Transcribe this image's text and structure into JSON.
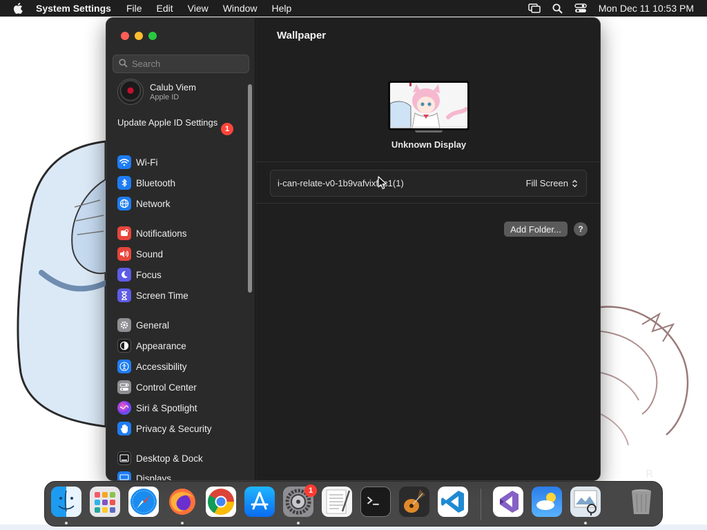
{
  "menubar": {
    "app_name": "System Settings",
    "menus": [
      "File",
      "Edit",
      "View",
      "Window",
      "Help"
    ],
    "clock": "Mon Dec 11  10:53 PM",
    "status_icons": [
      "screen-mirroring-icon",
      "spotlight-search-icon",
      "control-center-icon"
    ]
  },
  "window": {
    "search": {
      "placeholder": "Search"
    },
    "account": {
      "name": "Calub Viem",
      "subtitle": "Apple ID"
    },
    "update": {
      "label": "Update Apple ID Settings",
      "badge": "1"
    },
    "sidebar": {
      "items": [
        {
          "label": "Wi-Fi",
          "icon": "wifi-icon",
          "color": "#1e7cf2"
        },
        {
          "label": "Bluetooth",
          "icon": "bluetooth-icon",
          "color": "#1e7cf2"
        },
        {
          "label": "Network",
          "icon": "network-globe-icon",
          "color": "#1e7cf2"
        },
        {
          "label": "Notifications",
          "icon": "notifications-icon",
          "color": "#e8453c"
        },
        {
          "label": "Sound",
          "icon": "sound-icon",
          "color": "#e8453c"
        },
        {
          "label": "Focus",
          "icon": "focus-moon-icon",
          "color": "#5e5ce6"
        },
        {
          "label": "Screen Time",
          "icon": "screen-time-hourglass-icon",
          "color": "#5e5ce6"
        },
        {
          "label": "General",
          "icon": "general-gear-icon",
          "color": "#8e8e93"
        },
        {
          "label": "Appearance",
          "icon": "appearance-icon",
          "color": "#1c1c1e"
        },
        {
          "label": "Accessibility",
          "icon": "accessibility-icon",
          "color": "#1e7cf2"
        },
        {
          "label": "Control Center",
          "icon": "control-center-icon",
          "color": "#8e8e93"
        },
        {
          "label": "Siri & Spotlight",
          "icon": "siri-icon",
          "color": "#b84fd6"
        },
        {
          "label": "Privacy & Security",
          "icon": "privacy-hand-icon",
          "color": "#1e7cf2"
        },
        {
          "label": "Desktop & Dock",
          "icon": "desktop-dock-icon",
          "color": "#1c1c1e"
        },
        {
          "label": "Displays",
          "icon": "displays-icon",
          "color": "#1e7cf2"
        }
      ]
    },
    "content": {
      "title": "Wallpaper",
      "display_name": "Unknown Display",
      "wallpaper_name": "i-can-relate-v0-1b9vafvixf2c1(1)",
      "fill_mode": "Fill Screen",
      "add_folder_label": "Add Folder...",
      "help_label": "?"
    }
  },
  "dock": {
    "apps": [
      {
        "name": "Finder",
        "icon": "finder-icon",
        "running": true
      },
      {
        "name": "Launchpad",
        "icon": "launchpad-icon",
        "running": false
      },
      {
        "name": "Safari",
        "icon": "safari-icon",
        "running": false
      },
      {
        "name": "Firefox",
        "icon": "firefox-icon",
        "running": true
      },
      {
        "name": "Google Chrome",
        "icon": "chrome-icon",
        "running": false
      },
      {
        "name": "App Store",
        "icon": "app-store-icon",
        "running": false
      },
      {
        "name": "System Settings",
        "icon": "system-settings-icon",
        "running": true,
        "badge": "1"
      },
      {
        "name": "TextEdit",
        "icon": "textedit-icon",
        "running": false
      },
      {
        "name": "Terminal",
        "icon": "terminal-icon",
        "running": false
      },
      {
        "name": "GarageBand",
        "icon": "garageband-icon",
        "running": false
      },
      {
        "name": "Visual Studio Code",
        "icon": "vscode-icon",
        "running": false
      },
      {
        "name": "Visual Studio",
        "icon": "visual-studio-icon",
        "running": false
      },
      {
        "name": "Weather",
        "icon": "weather-icon",
        "running": false
      },
      {
        "name": "Preview",
        "icon": "preview-icon",
        "running": true
      },
      {
        "name": "Trash",
        "icon": "trash-icon",
        "running": false
      }
    ]
  }
}
